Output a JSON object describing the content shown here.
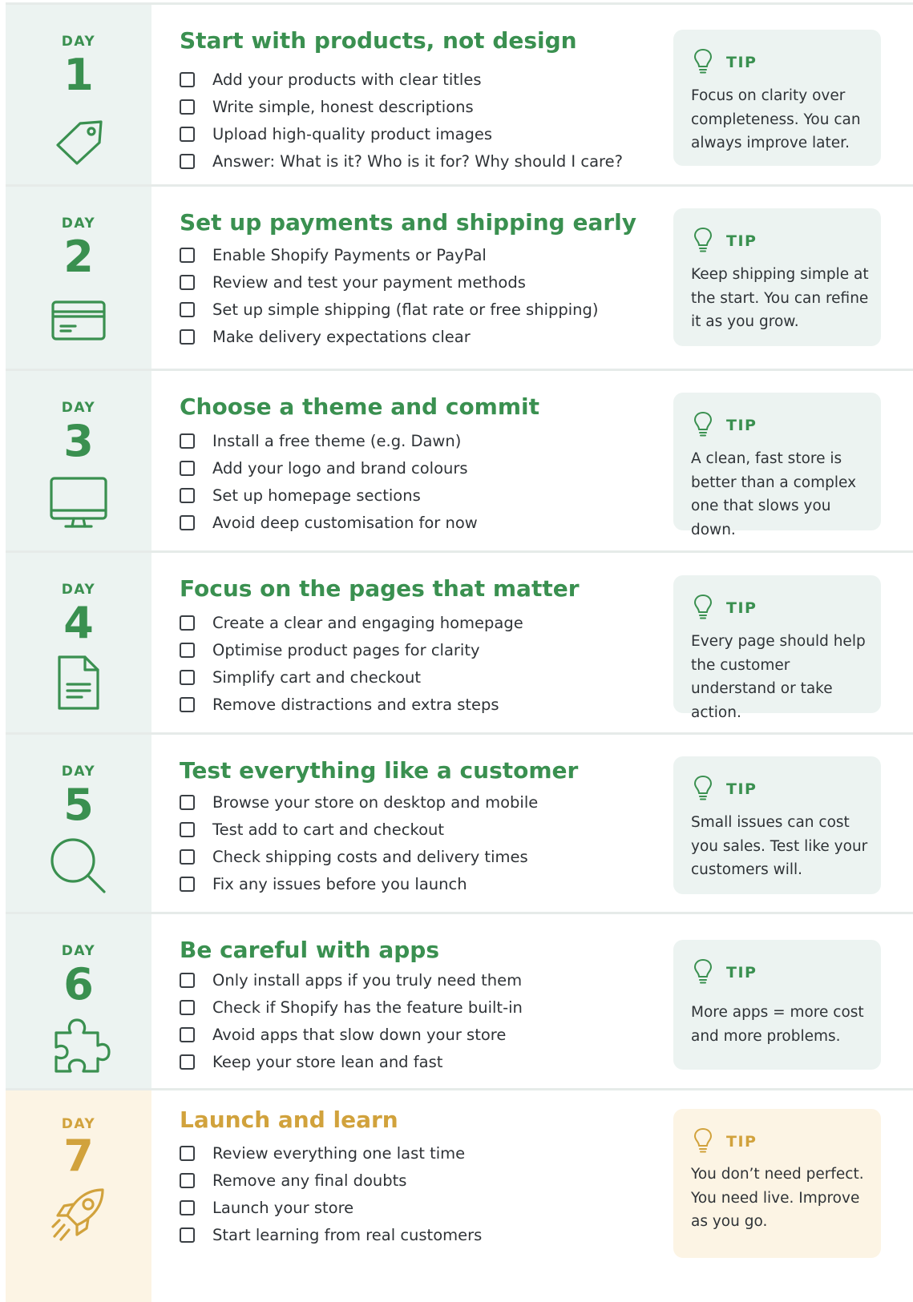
{
  "days": [
    {
      "label": "DAY",
      "number": "1",
      "icon": "tag-icon",
      "title": "Start with products, not design",
      "items": [
        "Add your products with clear titles",
        "Write simple, honest descriptions",
        "Upload high-quality product images",
        "Answer: What is it? Who is it for? Why should I care?"
      ],
      "tip": {
        "label": "TIP",
        "text": "Focus on clarity over completeness. You can always improve later."
      }
    },
    {
      "label": "DAY",
      "number": "2",
      "icon": "credit-card-icon",
      "title": "Set up payments and shipping early",
      "items": [
        "Enable Shopify Payments or PayPal",
        "Review and test your payment methods",
        "Set up simple shipping (flat rate or free shipping)",
        "Make delivery expectations clear"
      ],
      "tip": {
        "label": "TIP",
        "text": "Keep shipping simple at the start. You can refine it as you grow."
      }
    },
    {
      "label": "DAY",
      "number": "3",
      "icon": "monitor-icon",
      "title": "Choose a theme and commit",
      "items": [
        "Install a free theme (e.g. Dawn)",
        "Add your logo and brand colours",
        "Set up homepage sections",
        "Avoid deep customisation for now"
      ],
      "tip": {
        "label": "TIP",
        "text": "A clean, fast store is better than a complex one that slows you down."
      }
    },
    {
      "label": "DAY",
      "number": "4",
      "icon": "document-icon",
      "title": "Focus on the pages that matter",
      "items": [
        "Create a clear and engaging homepage",
        "Optimise product pages for clarity",
        "Simplify cart and checkout",
        "Remove distractions and extra steps"
      ],
      "tip": {
        "label": "TIP",
        "text": "Every page should help the customer understand or take action."
      }
    },
    {
      "label": "DAY",
      "number": "5",
      "icon": "magnifier-icon",
      "title": "Test everything like a customer",
      "items": [
        "Browse your store on desktop and mobile",
        "Test add to cart and checkout",
        "Check shipping costs and delivery times",
        "Fix any issues before you launch"
      ],
      "tip": {
        "label": "TIP",
        "text": "Small issues can cost you sales. Test like your customers will."
      }
    },
    {
      "label": "DAY",
      "number": "6",
      "icon": "puzzle-icon",
      "title": "Be careful with apps",
      "items": [
        "Only install apps if you truly need them",
        "Check if Shopify has the feature built-in",
        "Avoid apps that slow down your store",
        "Keep your store lean and fast"
      ],
      "tip": {
        "label": "TIP",
        "text": "More apps = more cost and more problems."
      }
    },
    {
      "label": "DAY",
      "number": "7",
      "icon": "rocket-icon",
      "title": "Launch and learn",
      "items": [
        "Review everything one last time",
        "Remove any final doubts",
        "Launch your store",
        "Start learning from real customers"
      ],
      "tip": {
        "label": "TIP",
        "text": "You don’t need perfect. You need live. Improve as you go."
      }
    }
  ],
  "colors": {
    "green": "#3a9050",
    "gold": "#d1a23c",
    "mint_panel": "#ecf3f1",
    "cream_panel": "#fcf4e4"
  }
}
